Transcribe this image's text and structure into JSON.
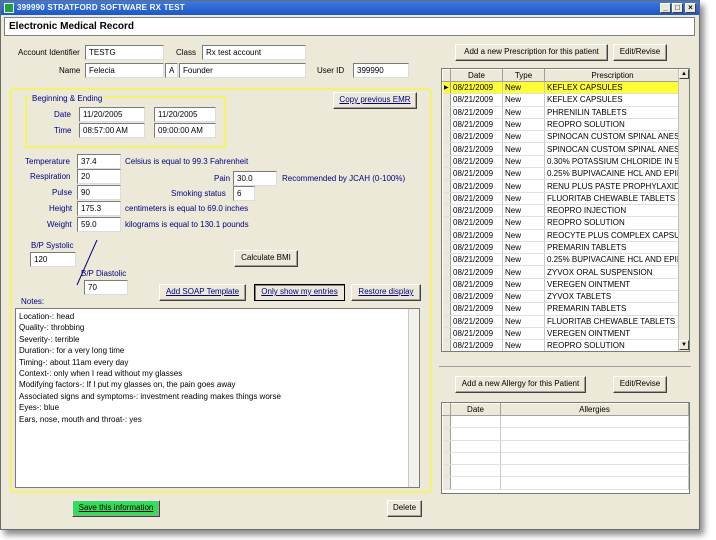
{
  "window": {
    "title": "399990 STRATFORD SOFTWARE RX TEST",
    "min_glyph": "_",
    "max_glyph": "□",
    "close_glyph": "×"
  },
  "app_header": "Electronic Medical Record",
  "patient": {
    "account_label": "Account Identifier",
    "account_value": "TESTG",
    "class_label": "Class",
    "class_value": "Rx test account",
    "name_label": "Name",
    "first_name": "Felecia",
    "middle_initial": "A",
    "last_name": "Founder",
    "user_label": "User ID",
    "user_value": "399990"
  },
  "visit": {
    "section_label": "Beginning & Ending",
    "date_label": "Date",
    "time_label": "Time",
    "start_date": "11/20/2005",
    "end_date": "11/20/2005",
    "start_time": "08:57:00 AM",
    "end_time": "09:00:00 AM",
    "copy_button": "Copy previous EMR"
  },
  "vitals": {
    "temperature_label": "Temperature",
    "temperature": "37.4",
    "temperature_note": "Celsius is equal to 99.3 Fahrenheit",
    "respiration_label": "Respiration",
    "respiration": "20",
    "pain_label": "Pain",
    "pain": "30.0",
    "pain_note": "Recommended by JCAH (0-100%)",
    "pulse_label": "Pulse",
    "pulse": "90",
    "smoking_label": "Smoking status",
    "smoking": "6",
    "height_label": "Height",
    "height": "175.3",
    "height_note": "centimeters is equal to 69.0 inches",
    "weight_label": "Weight",
    "weight": "59.0",
    "weight_note": "kilograms is equal to 130.1 pounds",
    "bp_systolic_label": "B/P Systolic",
    "bp_systolic": "120",
    "bp_diastolic_label": "B/P Diastolic",
    "bp_diastolic": "70",
    "calc_bmi_button": "Calculate BMI"
  },
  "notes_section": {
    "label": "Notes:",
    "add_soap_button": "Add SOAP Template",
    "only_mine_button": "Only show my entries",
    "restore_button": "Restore display",
    "lines": [
      "Location-:  head",
      "Quality-:   throbbing",
      "Severity-:  terrible",
      "Duration-:  for a very long time",
      "Timing-:   about 11am every day",
      "Context-:   only when I read without my glasses",
      "Modifying factors-:  If I put my glasses on, the pain goes away",
      "Associated signs and symptoms-:  investment reading makes things worse",
      "Eyes-:  blue",
      "Ears, nose, mouth and throat-:  yes"
    ]
  },
  "bottom": {
    "save_button": "Save this information",
    "delete_button": "Delete"
  },
  "prescriptions": {
    "add_button": "Add a new Prescription for this patient",
    "edit_button": "Edit/Revise",
    "columns": [
      "Date",
      "Type",
      "Prescription"
    ],
    "rows": [
      {
        "date": "08/21/2009",
        "type": "New",
        "rx": "KEFLEX CAPSULES"
      },
      {
        "date": "08/21/2009",
        "type": "New",
        "rx": "KEFLEX CAPSULES"
      },
      {
        "date": "08/21/2009",
        "type": "New",
        "rx": "PHRENILIN TABLETS"
      },
      {
        "date": "08/21/2009",
        "type": "New",
        "rx": "REOPRO SOLUTION"
      },
      {
        "date": "08/21/2009",
        "type": "New",
        "rx": "SPINOCAN CUSTOM SPINAL ANES"
      },
      {
        "date": "08/21/2009",
        "type": "New",
        "rx": "SPINOCAN CUSTOM SPINAL ANES"
      },
      {
        "date": "08/21/2009",
        "type": "New",
        "rx": "0.30% POTASSIUM CHLORIDE IN 5"
      },
      {
        "date": "08/21/2009",
        "type": "New",
        "rx": "0.25% BUPIVACAINE HCL AND EPII"
      },
      {
        "date": "08/21/2009",
        "type": "New",
        "rx": "RENU PLUS PASTE PROPHYLAXID"
      },
      {
        "date": "08/21/2009",
        "type": "New",
        "rx": "FLUORITAB CHEWABLE TABLETS"
      },
      {
        "date": "08/21/2009",
        "type": "New",
        "rx": "REOPRO INJECTION"
      },
      {
        "date": "08/21/2009",
        "type": "New",
        "rx": "REOPRO SOLUTION"
      },
      {
        "date": "08/21/2009",
        "type": "New",
        "rx": "REOCYTE PLUS COMPLEX CAPSU"
      },
      {
        "date": "08/21/2009",
        "type": "New",
        "rx": "PREMARIN TABLETS"
      },
      {
        "date": "08/21/2009",
        "type": "New",
        "rx": "0.25% BUPIVACAINE HCL AND EPII"
      },
      {
        "date": "08/21/2009",
        "type": "New",
        "rx": "ZYVOX ORAL SUSPENSION"
      },
      {
        "date": "08/21/2009",
        "type": "New",
        "rx": "VEREGEN OINTMENT"
      },
      {
        "date": "08/21/2009",
        "type": "New",
        "rx": "ZYVOX TABLETS"
      },
      {
        "date": "08/21/2009",
        "type": "New",
        "rx": "PREMARIN TABLETS"
      },
      {
        "date": "08/21/2009",
        "type": "New",
        "rx": "FLUORITAB CHEWABLE TABLETS"
      },
      {
        "date": "08/21/2009",
        "type": "New",
        "rx": "VEREGEN OINTMENT"
      },
      {
        "date": "08/21/2009",
        "type": "New",
        "rx": "REOPRO SOLUTION"
      }
    ]
  },
  "allergies": {
    "add_button": "Add a new Allergy for this Patient",
    "edit_button": "Edit/Revise",
    "columns": [
      "Date",
      "Allergies"
    ]
  },
  "colors": {
    "titlebar": "#1f56c8",
    "highlight_row": "#ffff33",
    "border_yellow": "#f4f46a",
    "save_green": "#33dd55",
    "label_blue": "#000080"
  },
  "icons": [
    "app-icon",
    "minimize-icon",
    "maximize-icon",
    "close-icon",
    "row-pointer-icon",
    "scroll-up-icon",
    "scroll-down-icon"
  ]
}
